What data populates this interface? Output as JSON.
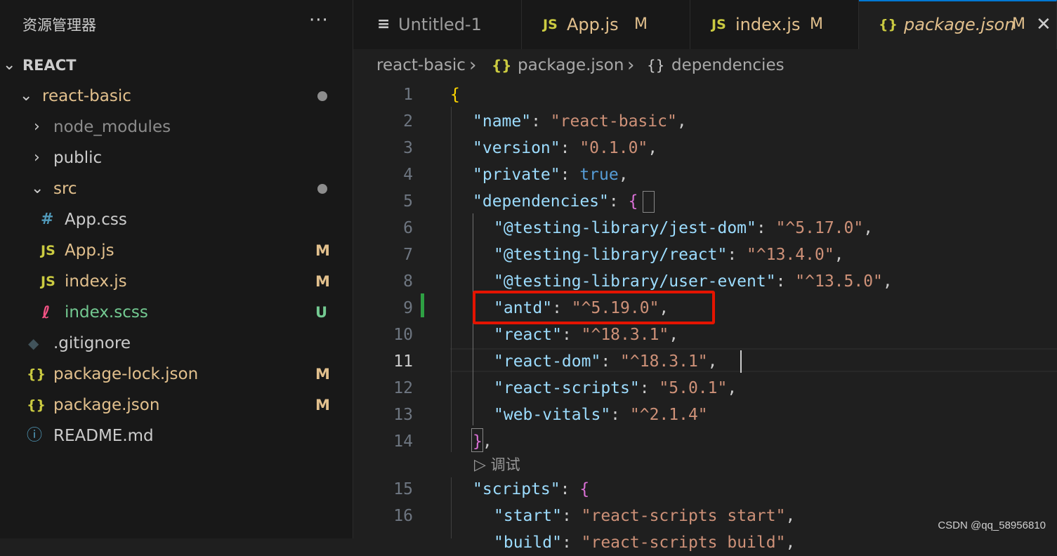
{
  "sidebar": {
    "title": "资源管理器",
    "more": "···",
    "root": "REACT",
    "items": [
      {
        "label": "react-basic",
        "icon": "",
        "status": "dot"
      },
      {
        "label": "node_modules",
        "icon": "",
        "status": ""
      },
      {
        "label": "public",
        "icon": "",
        "status": ""
      },
      {
        "label": "src",
        "icon": "",
        "status": "dot"
      },
      {
        "label": "App.css",
        "icon": "#",
        "status": ""
      },
      {
        "label": "App.js",
        "icon": "JS",
        "status": "M"
      },
      {
        "label": "index.js",
        "icon": "JS",
        "status": "M"
      },
      {
        "label": "index.scss",
        "icon": "ℓ",
        "status": "U"
      },
      {
        "label": ".gitignore",
        "icon": "◆",
        "status": ""
      },
      {
        "label": "package-lock.json",
        "icon": "{}",
        "status": "M"
      },
      {
        "label": "package.json",
        "icon": "{}",
        "status": "M"
      },
      {
        "label": "README.md",
        "icon": "ⓘ",
        "status": ""
      }
    ]
  },
  "tabs": [
    {
      "label": "Untitled-1",
      "icon": "≡",
      "modified": ""
    },
    {
      "label": "App.js",
      "icon": "JS",
      "modified": "M"
    },
    {
      "label": "index.js",
      "icon": "JS",
      "modified": "M"
    },
    {
      "label": "package.json",
      "icon": "{}",
      "modified": "M",
      "close": "✕"
    }
  ],
  "breadcrumb": {
    "folder": "react-basic",
    "sep1": "›",
    "file_icon": "{}",
    "file": "package.json",
    "sep2": "›",
    "node_icon": "{}",
    "node": "dependencies"
  },
  "editor": {
    "line_numbers": [
      "1",
      "2",
      "3",
      "4",
      "5",
      "6",
      "7",
      "8",
      "9",
      "10",
      "11",
      "12",
      "13",
      "14",
      "15",
      "16"
    ],
    "current_line": "11",
    "codelens": "调试",
    "lines": {
      "l1": {
        "brace": "{"
      },
      "l2": {
        "key": "\"name\"",
        "colon": ": ",
        "value": "\"react-basic\"",
        "comma": ","
      },
      "l3": {
        "key": "\"version\"",
        "colon": ": ",
        "value": "\"0.1.0\"",
        "comma": ","
      },
      "l4": {
        "key": "\"private\"",
        "colon": ": ",
        "value": "true",
        "comma": ","
      },
      "l5": {
        "key": "\"dependencies\"",
        "colon": ": ",
        "brace": "{"
      },
      "l6": {
        "key": "\"@testing-library/jest-dom\"",
        "colon": ": ",
        "value": "\"^5.17.0\"",
        "comma": ","
      },
      "l7": {
        "key": "\"@testing-library/react\"",
        "colon": ": ",
        "value": "\"^13.4.0\"",
        "comma": ","
      },
      "l8": {
        "key": "\"@testing-library/user-event\"",
        "colon": ": ",
        "value": "\"^13.5.0\"",
        "comma": ","
      },
      "l9": {
        "key": "\"antd\"",
        "colon": ": ",
        "value": "\"^5.19.0\"",
        "comma": ","
      },
      "l10": {
        "key": "\"react\"",
        "colon": ": ",
        "value": "\"^18.3.1\"",
        "comma": ","
      },
      "l11": {
        "key": "\"react-dom\"",
        "colon": ": ",
        "value": "\"^18.3.1\"",
        "comma": ","
      },
      "l12": {
        "key": "\"react-scripts\"",
        "colon": ": ",
        "value": "\"5.0.1\"",
        "comma": ","
      },
      "l13": {
        "key": "\"web-vitals\"",
        "colon": ": ",
        "value": "\"^2.1.4\""
      },
      "l14": {
        "brace": "}",
        "comma": ","
      },
      "l15": {
        "key": "\"scripts\"",
        "colon": ": ",
        "brace": "{"
      },
      "l16": {
        "key": "\"start\"",
        "colon": ": ",
        "value": "\"react-scripts start\"",
        "comma": ","
      },
      "l17": {
        "key": "\"build\"",
        "colon": ": ",
        "value": "\"react-scripts build\"",
        "comma": ","
      }
    }
  },
  "colors": {
    "json_key": "#9cdcfe",
    "json_string": "#ce9178",
    "json_boolean": "#569cd6",
    "bracket_level1": "#ffd700",
    "bracket_level2": "#da70d6",
    "modified_badge": "#e2c08d",
    "untracked_badge": "#73c991",
    "highlight_box": "#e51400"
  },
  "watermark": "CSDN @qq_58956810"
}
